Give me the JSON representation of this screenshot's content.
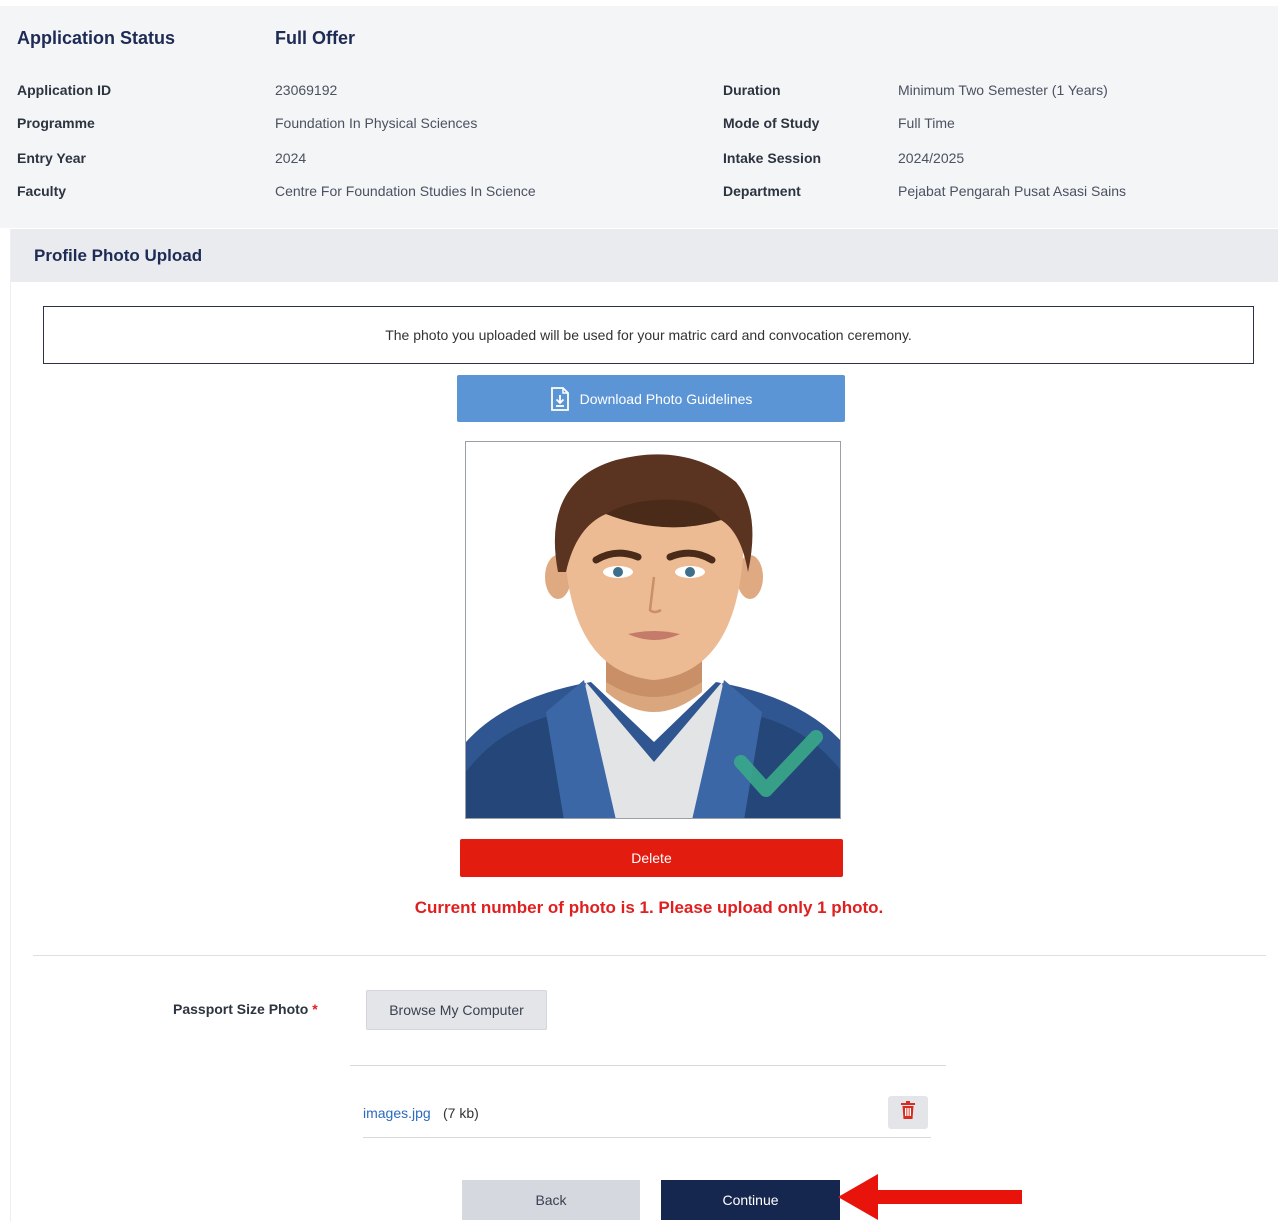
{
  "application": {
    "status_label": "Application Status",
    "status_value": "Full Offer",
    "left_fields": [
      {
        "label": "Application ID",
        "value": "23069192"
      },
      {
        "label": "Programme",
        "value": "Foundation In Physical Sciences"
      },
      {
        "label": "Entry Year",
        "value": "2024"
      },
      {
        "label": "Faculty",
        "value": "Centre For Foundation Studies In Science"
      }
    ],
    "right_fields": [
      {
        "label": "Duration",
        "value": "Minimum Two Semester (1 Years)"
      },
      {
        "label": "Mode of Study",
        "value": "Full Time"
      },
      {
        "label": "Intake Session",
        "value": "2024/2025"
      },
      {
        "label": "Department",
        "value": "Pejabat Pengarah Pusat Asasi Sains"
      }
    ]
  },
  "upload": {
    "title": "Profile Photo Upload",
    "notice": "The photo you uploaded will be used for your matric card and convocation ceremony.",
    "download_label": "Download Photo Guidelines",
    "delete_label": "Delete",
    "warning": "Current number of photo is 1. Please upload only 1 photo.",
    "field_label": "Passport Size Photo",
    "required_mark": "*",
    "browse_label": "Browse My Computer",
    "file": {
      "name": "images.jpg",
      "size": "(7 kb)"
    }
  },
  "actions": {
    "back_label": "Back",
    "continue_label": "Continue"
  },
  "icons": {
    "download": "file-download-icon",
    "trash": "trash-icon",
    "arrow": "arrow-left-icon"
  },
  "colors": {
    "primary_navy": "#16274f",
    "download_blue": "#5b95d6",
    "danger_red": "#e21c0e",
    "warning_red": "#e02020",
    "arrow_red": "#e8140c"
  }
}
